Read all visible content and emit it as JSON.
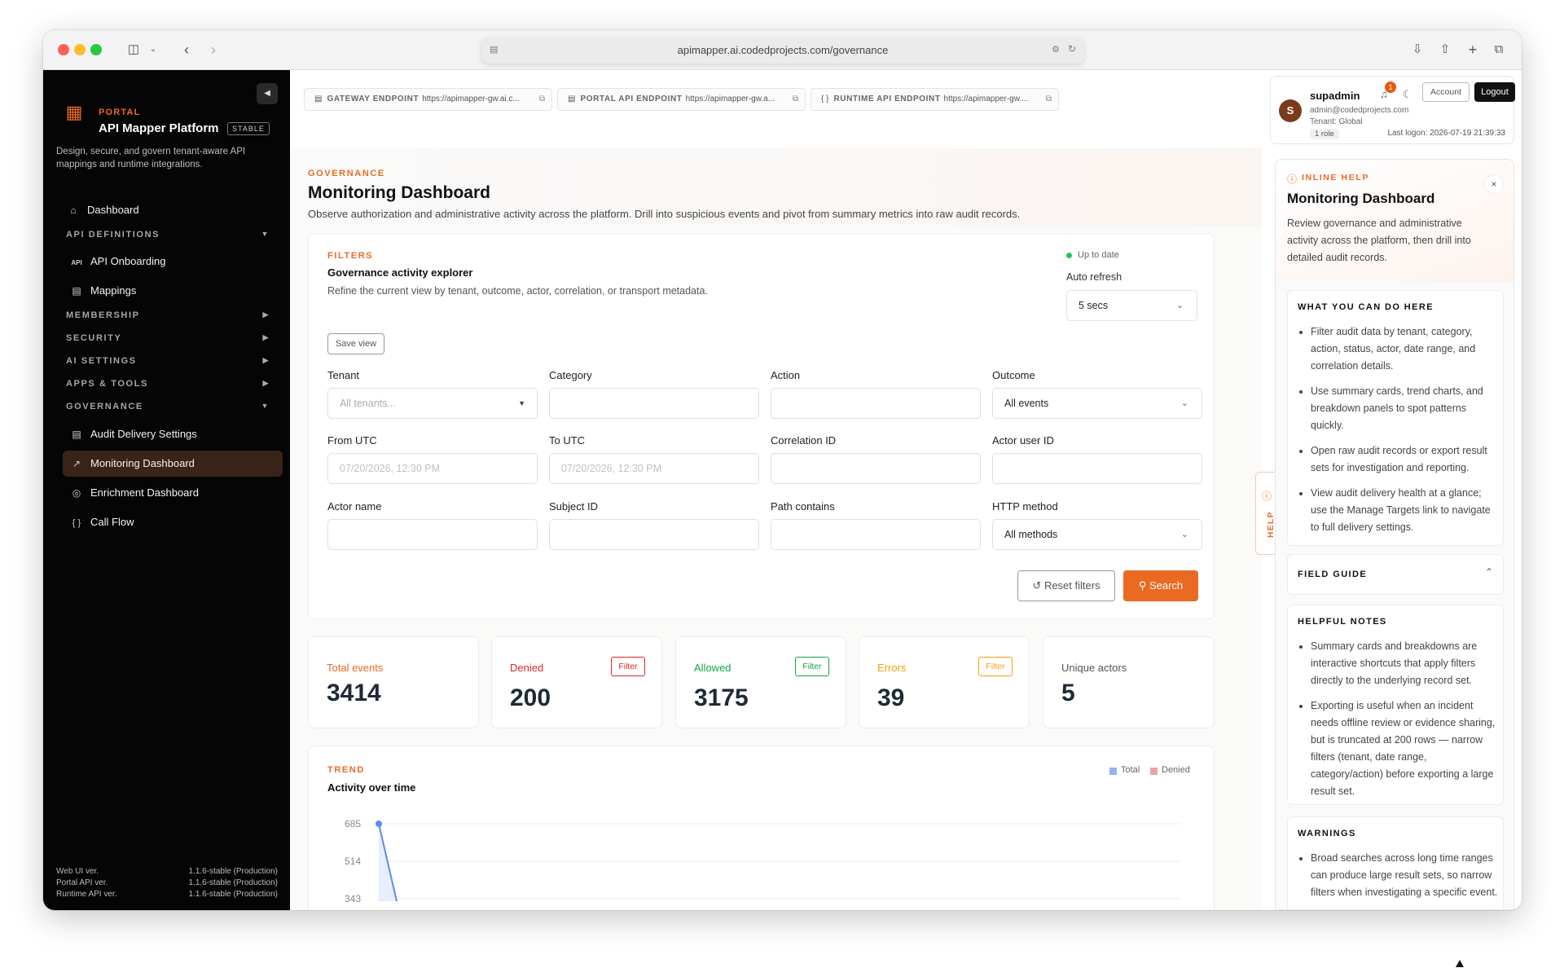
{
  "browser": {
    "url": "apimapper.ai.codedprojects.com/governance"
  },
  "brand": {
    "sup": "PORTAL",
    "name": "API Mapper Platform",
    "badge": "STABLE",
    "desc": "Design, secure, and govern tenant-aware API mappings and runtime integrations."
  },
  "nav": {
    "dashboard": "Dashboard",
    "api_definitions": "API DEFINITIONS",
    "api_onboarding": "API Onboarding",
    "mappings": "Mappings",
    "membership": "MEMBERSHIP",
    "security": "SECURITY",
    "ai_settings": "AI SETTINGS",
    "apps_tools": "APPS & TOOLS",
    "governance": "GOVERNANCE",
    "audit_delivery": "Audit Delivery Settings",
    "monitoring": "Monitoring Dashboard",
    "enrichment": "Enrichment Dashboard",
    "call_flow": "Call Flow"
  },
  "versions": [
    {
      "label": "Web UI ver.",
      "value": "1.1.6-stable (Production)"
    },
    {
      "label": "Portal API ver.",
      "value": "1.1.6-stable (Production)"
    },
    {
      "label": "Runtime API ver.",
      "value": "1.1.6-stable (Production)"
    }
  ],
  "endpoints": [
    {
      "label": "GATEWAY ENDPOINT",
      "url": "https://apimapper-gw.ai.c..."
    },
    {
      "label": "PORTAL API ENDPOINT",
      "url": "https://apimapper-gw.a..."
    },
    {
      "label": "RUNTIME API ENDPOINT",
      "url": "https://apimapper-gw...."
    }
  ],
  "user": {
    "initial": "S",
    "name": "supadmin",
    "notifications": "1",
    "email": "admin@codedprojects.com",
    "tenant": "Tenant: Global",
    "role": "1 role",
    "last_logon": "Last logon: 2026-07-19 21:39:33",
    "account_label": "Account",
    "logout_label": "Logout"
  },
  "page": {
    "eyebrow": "GOVERNANCE",
    "title": "Monitoring Dashboard",
    "desc": "Observe authorization and administrative activity across the platform. Drill into suspicious events and pivot from summary metrics into raw audit records."
  },
  "filters": {
    "eyebrow": "FILTERS",
    "title": "Governance activity explorer",
    "desc": "Refine the current view by tenant, outcome, actor, correlation, or transport metadata.",
    "status": "Up to date",
    "auto_refresh_label": "Auto refresh",
    "auto_refresh_value": "5 secs",
    "save_view": "Save view",
    "tenant_label": "Tenant",
    "tenant_placeholder": "All tenants...",
    "category_label": "Category",
    "action_label": "Action",
    "outcome_label": "Outcome",
    "outcome_value": "All events",
    "from_label": "From UTC",
    "from_placeholder": "07/20/2026, 12:30 PM",
    "to_label": "To UTC",
    "to_placeholder": "07/20/2026, 12:30 PM",
    "correlation_label": "Correlation ID",
    "actor_user_label": "Actor user ID",
    "actor_name_label": "Actor name",
    "subject_label": "Subject ID",
    "path_label": "Path contains",
    "method_label": "HTTP method",
    "method_value": "All methods",
    "reset_label": "Reset filters",
    "search_label": "Search"
  },
  "stats": [
    {
      "label": "Total events",
      "value": "3414",
      "color": "#ea6a24"
    },
    {
      "label": "Denied",
      "value": "200",
      "color": "#dc2626",
      "filter": "Filter"
    },
    {
      "label": "Allowed",
      "value": "3175",
      "color": "#16a34a",
      "filter": "Filter"
    },
    {
      "label": "Errors",
      "value": "39",
      "color": "#f59e0b",
      "filter": "Filter"
    },
    {
      "label": "Unique actors",
      "value": "5",
      "color": "#555555"
    }
  ],
  "trend": {
    "eyebrow": "TREND",
    "title": "Activity over time",
    "legend_total": "Total",
    "legend_denied": "Denied",
    "ticks": [
      "685",
      "514",
      "343"
    ]
  },
  "help": {
    "eyebrow": "INLINE HELP",
    "tab_label": "HELP",
    "title": "Monitoring Dashboard",
    "desc": "Review governance and administrative activity across the platform, then drill into detailed audit records.",
    "what_title": "WHAT YOU CAN DO HERE",
    "what_items": [
      "Filter audit data by tenant, category, action, status, actor, date range, and correlation details.",
      "Use summary cards, trend charts, and breakdown panels to spot patterns quickly.",
      "Open raw audit records or export result sets for investigation and reporting.",
      "View audit delivery health at a glance; use the Manage Targets link to navigate to full delivery settings."
    ],
    "field_guide": "FIELD GUIDE",
    "notes_title": "HELPFUL NOTES",
    "notes_items": [
      "Summary cards and breakdowns are interactive shortcuts that apply filters directly to the underlying record set.",
      "Exporting is useful when an incident needs offline review or evidence sharing, but is truncated at 200 rows — narrow filters (tenant, date range, category/action) before exporting a large result set."
    ],
    "warnings_title": "WARNINGS",
    "warnings_items": [
      "Broad searches across long time ranges can produce large result sets, so narrow filters when investigating a specific event."
    ]
  }
}
